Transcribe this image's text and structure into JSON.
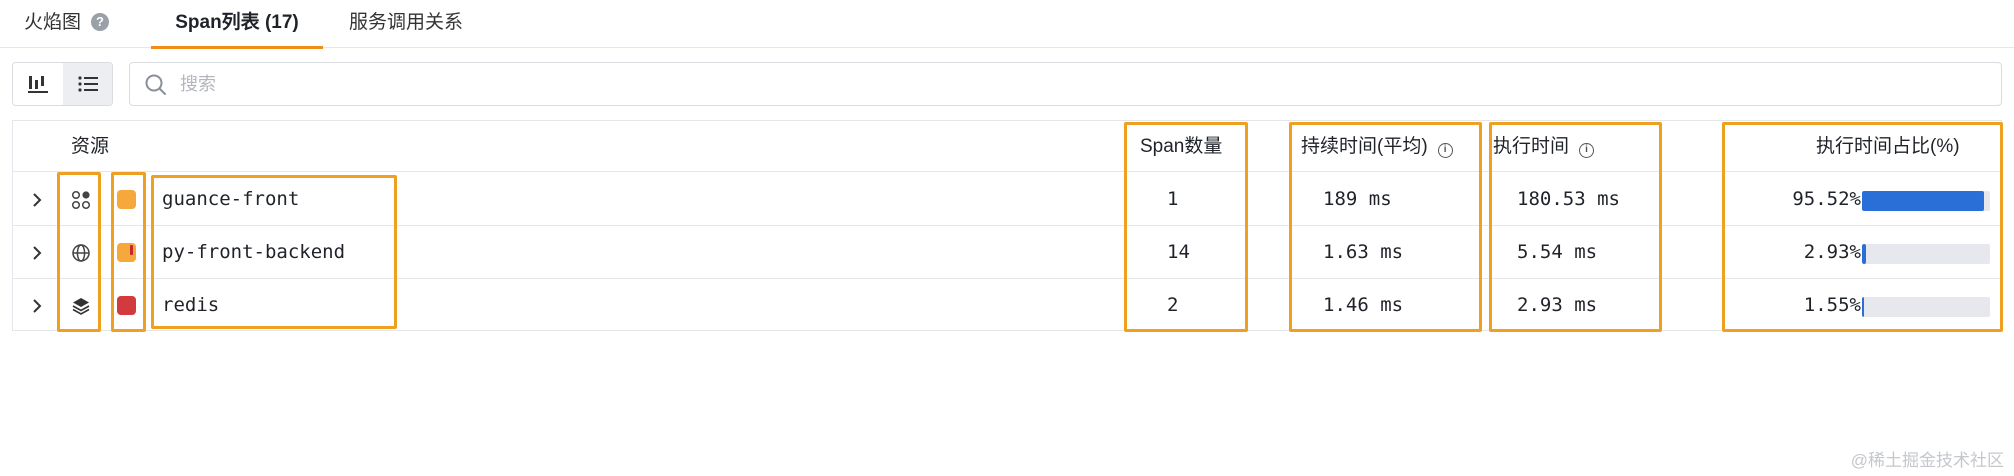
{
  "tabs": [
    {
      "label": "火焰图"
    },
    {
      "label": "Span列表 (17)"
    },
    {
      "label": "服务调用关系"
    }
  ],
  "help_icon_glyph": "?",
  "search": {
    "placeholder": "搜索",
    "value": ""
  },
  "table": {
    "columns": {
      "resource": "资源",
      "span_count": "Span数量",
      "avg_duration": "持续时间(平均)",
      "exec_time": "执行时间",
      "exec_ratio": "执行时间占比(%)"
    },
    "info_glyph": "i",
    "rows": [
      {
        "type_icon": "app-icon",
        "status_color": "#f6a83c",
        "warn": false,
        "name": "guance-front",
        "span_count": "1",
        "avg_duration": "189 ms",
        "exec_time": "180.53 ms",
        "exec_ratio": "95.52%",
        "ratio": 0.9552
      },
      {
        "type_icon": "globe-icon",
        "status_color": "#f6a83c",
        "warn": true,
        "name": "py-front-backend",
        "span_count": "14",
        "avg_duration": "1.63 ms",
        "exec_time": "5.54 ms",
        "exec_ratio": "2.93%",
        "ratio": 0.0293
      },
      {
        "type_icon": "layers-icon",
        "status_color": "#d23a3e",
        "warn": false,
        "name": "redis",
        "span_count": "2",
        "avg_duration": "1.46 ms",
        "exec_time": "2.93 ms",
        "exec_ratio": "1.55%",
        "ratio": 0.0155
      }
    ]
  },
  "colors": {
    "accent": "#f08c1a",
    "highlight_box": "#f0a020",
    "bar": "#2a6fd8",
    "bar_track": "#e6e8ed"
  },
  "watermark": "@稀土掘金技术社区"
}
